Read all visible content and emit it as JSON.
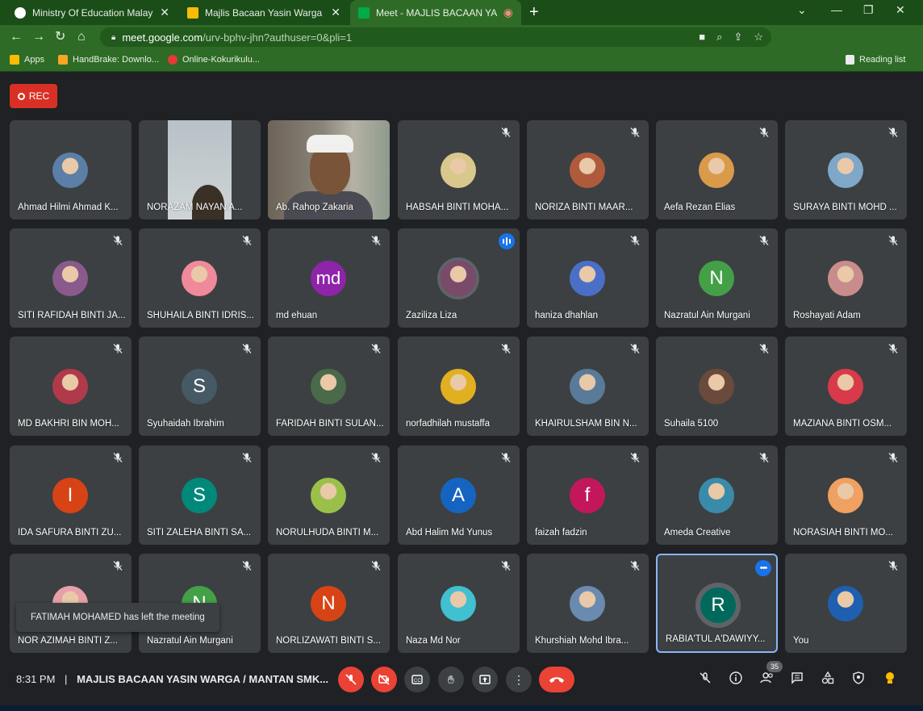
{
  "browser": {
    "tabs": [
      {
        "title": "Ministry Of Education Malaysia -",
        "favicon": "#ffffff",
        "active": false
      },
      {
        "title": "Majlis Bacaan Yasin Warga Mant",
        "favicon": "#fbbc04",
        "active": false
      },
      {
        "title": "Meet - MAJLIS BACAAN YAS",
        "favicon": "#00ac47",
        "active": true
      }
    ],
    "url_host": "meet.google.com",
    "url_path": "/urv-bphv-jhn?authuser=0&pli=1",
    "bookmarks": [
      {
        "label": "Apps",
        "color": "#fbbc04"
      },
      {
        "label": "HandBrake: Downlo...",
        "color": "#f5a623"
      },
      {
        "label": "Online-Kokurikulu...",
        "color": "#e53935"
      }
    ],
    "reading_list": "Reading list"
  },
  "meet": {
    "rec_label": "REC",
    "tiles": [
      {
        "name": "Ahmad Hilmi Ahmad K...",
        "kind": "photo",
        "color": "#5b7fa6",
        "muted": false
      },
      {
        "name": "NORAZAM NAYAN A...",
        "kind": "video1",
        "muted": false
      },
      {
        "name": "Ab. Rahop Zakaria",
        "kind": "video2",
        "muted": false
      },
      {
        "name": "HABSAH BINTI MOHA...",
        "kind": "photo",
        "color": "#d9c88b",
        "muted": true
      },
      {
        "name": "NORIZA BINTI MAAR...",
        "kind": "photo",
        "color": "#b05a3c",
        "muted": true
      },
      {
        "name": "Aefa Rezan Elias",
        "kind": "photo",
        "color": "#d99a4a",
        "muted": true
      },
      {
        "name": "SURAYA BINTI MOHD ...",
        "kind": "photo",
        "color": "#7fa7c7",
        "muted": true
      },
      {
        "name": "SITI RAFIDAH BINTI JA...",
        "kind": "photo",
        "color": "#8a5a8c",
        "muted": true
      },
      {
        "name": "SHUHAILA BINTI IDRIS...",
        "kind": "photo",
        "color": "#f08a9a",
        "muted": true
      },
      {
        "name": "md ehuan",
        "kind": "letter",
        "letter": "md",
        "color": "#8e24aa",
        "muted": true
      },
      {
        "name": "Zaziliza Liza",
        "kind": "photo",
        "color": "#7a4a6a",
        "muted": false,
        "speaking": true
      },
      {
        "name": "haniza dhahlan",
        "kind": "photo",
        "color": "#4a6fc7",
        "muted": true
      },
      {
        "name": "Nazratul Ain Murgani",
        "kind": "letter",
        "letter": "N",
        "color": "#43a047",
        "muted": true
      },
      {
        "name": "Roshayati Adam",
        "kind": "photo",
        "color": "#c98c8c",
        "muted": true
      },
      {
        "name": "MD BAKHRI BIN MOH...",
        "kind": "photo",
        "color": "#b03a4a",
        "muted": true
      },
      {
        "name": "Syuhaidah Ibrahim",
        "kind": "letter",
        "letter": "S",
        "color": "#455a64",
        "muted": true
      },
      {
        "name": "FARIDAH BINTI SULAN...",
        "kind": "photo",
        "color": "#4a6a4a",
        "muted": true
      },
      {
        "name": "norfadhilah mustaffa",
        "kind": "photo",
        "color": "#e0b020",
        "muted": true
      },
      {
        "name": "KHAIRULSHAM BIN N...",
        "kind": "photo",
        "color": "#5a7a9a",
        "muted": true
      },
      {
        "name": "Suhaila 5100",
        "kind": "photo",
        "color": "#6a4a3a",
        "muted": true
      },
      {
        "name": "MAZIANA BINTI OSM...",
        "kind": "photo",
        "color": "#d83a4a",
        "muted": true
      },
      {
        "name": "IDA SAFURA BINTI ZU...",
        "kind": "letter",
        "letter": "I",
        "color": "#d84315",
        "muted": true
      },
      {
        "name": "SITI ZALEHA BINTI SA...",
        "kind": "letter",
        "letter": "S",
        "color": "#00897b",
        "muted": true
      },
      {
        "name": "NORULHUDA BINTI M...",
        "kind": "photo",
        "color": "#9ac04a",
        "muted": true
      },
      {
        "name": "Abd Halim Md Yunus",
        "kind": "letter",
        "letter": "A",
        "color": "#1565c0",
        "muted": true
      },
      {
        "name": "faizah fadzin",
        "kind": "letter",
        "letter": "f",
        "color": "#c2185b",
        "muted": true
      },
      {
        "name": "Ameda Creative",
        "kind": "photo",
        "color": "#3a8aaa",
        "muted": true
      },
      {
        "name": "NORASIAH BINTI MO...",
        "kind": "photo",
        "color": "#f0a060",
        "muted": true
      },
      {
        "name": "NOR AZIMAH BINTI Z...",
        "kind": "photo",
        "color": "#e8a0a8",
        "muted": true
      },
      {
        "name": "Nazratul Ain Murgani",
        "kind": "letter",
        "letter": "N",
        "color": "#43a047",
        "muted": true
      },
      {
        "name": "NORLIZAWATI BINTI S...",
        "kind": "letter",
        "letter": "N",
        "color": "#d84315",
        "muted": true
      },
      {
        "name": "Naza Md Nor",
        "kind": "photo",
        "color": "#40c0d0",
        "muted": true
      },
      {
        "name": "Khurshiah Mohd Ibra...",
        "kind": "photo",
        "color": "#6a8ab0",
        "muted": true
      },
      {
        "name": "RABIA'TUL A'DAWIYY...",
        "kind": "letter",
        "letter": "R",
        "color": "#00695c",
        "muted": false,
        "highlight": true
      },
      {
        "name": "You",
        "kind": "photo",
        "color": "#1e5fb0",
        "muted": true
      }
    ],
    "toast": "FATIMAH MOHAMED has left the meeting",
    "time": "8:31 PM",
    "separator": "|",
    "meeting_title": "MAJLIS BACAAN YASIN WARGA / MANTAN SMK...",
    "participant_count": "35"
  }
}
